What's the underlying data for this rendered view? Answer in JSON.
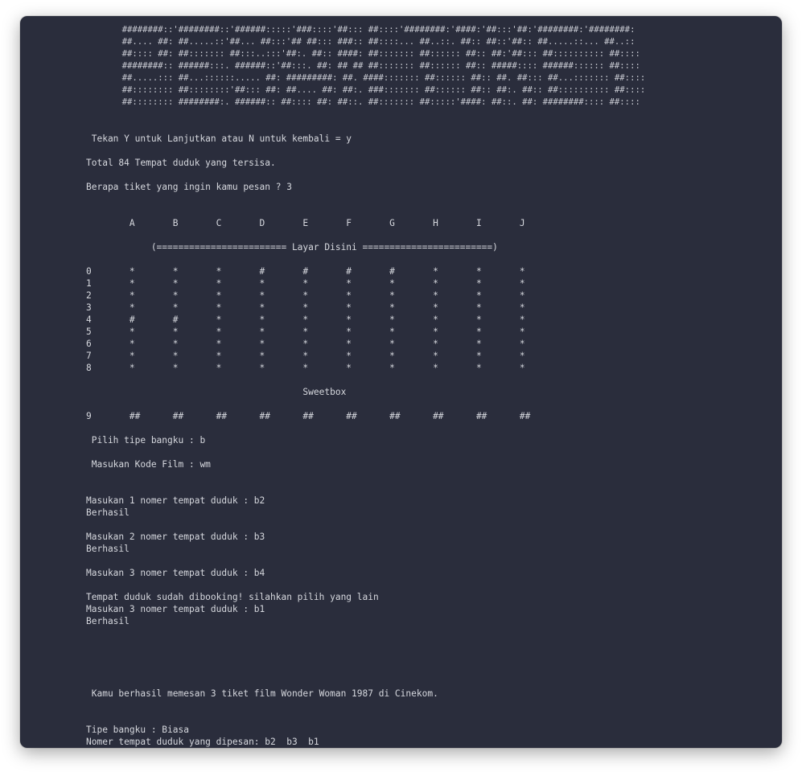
{
  "terminal": {
    "lines": [
      "       ########::'########::'######:::::'###::::'##::: ##::::'########:'####:'##:::'##:'########:'########:",
      "       ##.... ##: ##.....::'##... ##:::'## ##::: ###:: ##::::... ##..::. ##:: ##::'##:: ##.....::... ##..::",
      "       ##:::: ##: ##::::::: ##:::..:::'##:. ##:: ####: ##::::::: ##:::::: ##:: ##:'##::: ##:::::::::: ##::::",
      "       ########:: ######:::. ######::'##:::. ##: ## ## ##::::::: ##:::::: ##:: #####:::: ######:::::: ##::::",
      "       ##.....::: ##...::::::..... ##: #########: ##. ####::::::: ##:::::: ##:: ##. ##::: ##...::::::: ##::::",
      "       ##:::::::: ##::::::::'##::: ##: ##.... ##: ##:. ###::::::: ##:::::: ##:: ##:. ##:: ##:::::::::: ##::::",
      "       ##:::::::: ########:. ######:: ##:::: ##: ##::. ##::::::: ##:::::'####: ##::. ##: ########:::: ##::::",
      "",
      "",
      " Tekan Y untuk Lanjutkan atau N untuk kembali = y",
      "",
      "Total 84 Tempat duduk yang tersisa.",
      "",
      "Berapa tiket yang ingin kamu pesan ? 3",
      "",
      "",
      "        A       B       C       D       E       F       G       H       I       J",
      "",
      "            (======================== Layar Disini ========================)",
      "",
      "0       *       *       *       #       #       #       #       *       *       *",
      "1       *       *       *       *       *       *       *       *       *       *",
      "2       *       *       *       *       *       *       *       *       *       *",
      "3       *       *       *       *       *       *       *       *       *       *",
      "4       #       #       *       *       *       *       *       *       *       *",
      "5       *       *       *       *       *       *       *       *       *       *",
      "6       *       *       *       *       *       *       *       *       *       *",
      "7       *       *       *       *       *       *       *       *       *       *",
      "8       *       *       *       *       *       *       *       *       *       *",
      "",
      "                                        Sweetbox",
      "",
      "9       ##      ##      ##      ##      ##      ##      ##      ##      ##      ##",
      "",
      " Pilih tipe bangku : b",
      "",
      " Masukan Kode Film : wm",
      "",
      "",
      "Masukan 1 nomer tempat duduk : b2",
      "Berhasil",
      "",
      "Masukan 2 nomer tempat duduk : b3",
      "Berhasil",
      "",
      "Masukan 3 nomer tempat duduk : b4",
      "",
      "Tempat duduk sudah dibooking! silahkan pilih yang lain",
      "Masukan 3 nomer tempat duduk : b1",
      "Berhasil",
      "",
      "",
      "",
      "",
      "",
      " Kamu berhasil memesan 3 tiket film Wonder Woman 1987 di Cinekom.",
      "",
      "",
      "Tipe bangku : Biasa",
      "Nomer tempat duduk yang dipesan: b2  b3  b1"
    ]
  }
}
